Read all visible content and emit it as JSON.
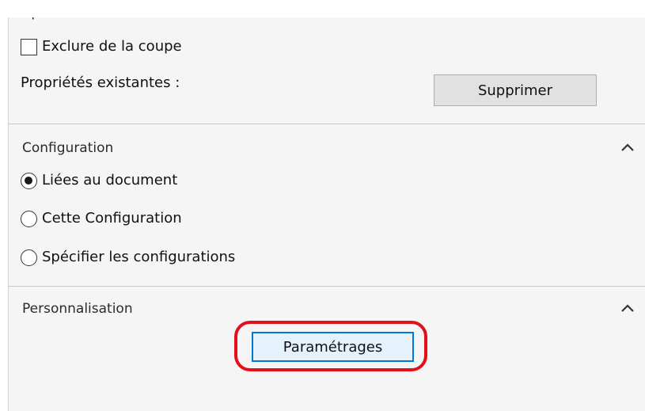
{
  "options": {
    "title": "Options",
    "exclude_cut_label": "Exclure de la coupe",
    "exclude_cut_checked": false,
    "existing_properties_label": "Propriétés existantes :",
    "delete_button": "Supprimer"
  },
  "configuration": {
    "title": "Configuration",
    "collapse_icon": "chevron-up-icon",
    "options": [
      {
        "label": "Liées au document",
        "checked": true
      },
      {
        "label": "Cette Configuration",
        "checked": false
      },
      {
        "label": "Spécifier les configurations",
        "checked": false
      }
    ]
  },
  "personalization": {
    "title": "Personnalisation",
    "collapse_icon": "chevron-up-icon",
    "settings_button": "Paramétrages"
  },
  "colors": {
    "panel_bg": "#f5f5f5",
    "focus_border": "#0078d7",
    "highlight_ring": "#e3101c"
  }
}
